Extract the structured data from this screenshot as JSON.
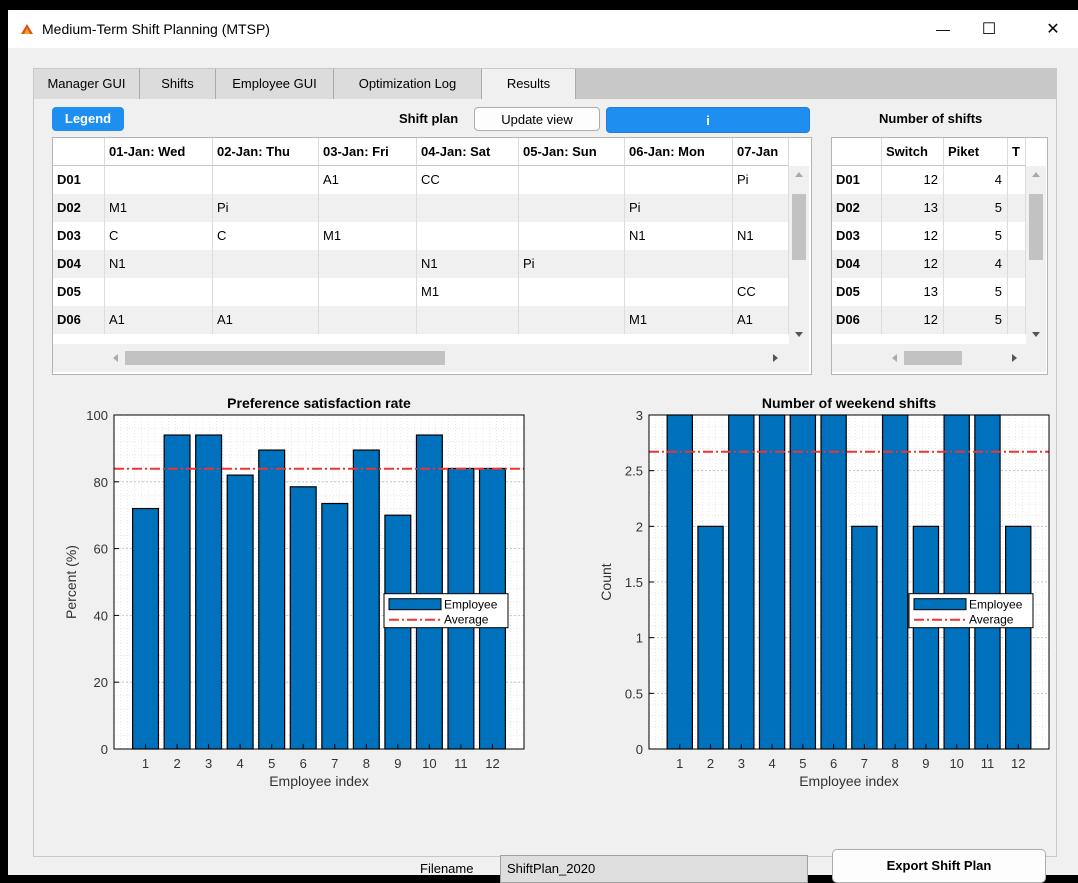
{
  "window": {
    "title": "Medium-Term Shift Planning (MTSP)",
    "minimize": "—",
    "maximize": "☐",
    "close": "✕"
  },
  "tabs": [
    {
      "label": "Manager GUI"
    },
    {
      "label": "Shifts"
    },
    {
      "label": "Employee GUI"
    },
    {
      "label": "Optimization Log"
    },
    {
      "label": "Results"
    }
  ],
  "results": {
    "legend_button": "Legend",
    "shift_plan_label": "Shift plan",
    "update_view_button": "Update view",
    "info_button": "i",
    "number_of_shifts_label": "Number of shifts"
  },
  "shift_table": {
    "columns": [
      "",
      "01-Jan: Wed",
      "02-Jan: Thu",
      "03-Jan: Fri",
      "04-Jan: Sat",
      "05-Jan: Sun",
      "06-Jan: Mon",
      "07-Jan"
    ],
    "rows": [
      [
        "D01",
        "",
        "",
        "A1",
        "CC",
        "",
        "",
        "Pi"
      ],
      [
        "D02",
        "M1",
        "Pi",
        "",
        "",
        "",
        "Pi",
        ""
      ],
      [
        "D03",
        "C",
        "C",
        "M1",
        "",
        "",
        "N1",
        "N1"
      ],
      [
        "D04",
        "N1",
        "",
        "",
        "N1",
        "Pi",
        "",
        ""
      ],
      [
        "D05",
        "",
        "",
        "",
        "M1",
        "",
        "",
        "CC"
      ],
      [
        "D06",
        "A1",
        "A1",
        "",
        "",
        "",
        "M1",
        "A1"
      ]
    ]
  },
  "count_table": {
    "columns": [
      "",
      "Switch",
      "Piket",
      "T"
    ],
    "rows": [
      [
        "D01",
        "12",
        "4"
      ],
      [
        "D02",
        "13",
        "5"
      ],
      [
        "D03",
        "12",
        "5"
      ],
      [
        "D04",
        "12",
        "4"
      ],
      [
        "D05",
        "13",
        "5"
      ],
      [
        "D06",
        "12",
        "5"
      ]
    ]
  },
  "chart_data": [
    {
      "type": "bar",
      "title": "Preference satisfaction rate",
      "xlabel": "Employee index",
      "ylabel": "Percent (%)",
      "categories": [
        "1",
        "2",
        "3",
        "4",
        "5",
        "6",
        "7",
        "8",
        "9",
        "10",
        "11",
        "12"
      ],
      "series": [
        {
          "name": "Employee",
          "values": [
            72,
            94,
            94,
            82,
            89.5,
            78.5,
            73.5,
            89.5,
            70,
            94,
            84,
            84
          ]
        },
        {
          "name": "Average",
          "values": [
            83.9
          ]
        }
      ],
      "ylim": [
        0,
        100
      ],
      "yticks": [
        "0",
        "20",
        "40",
        "60",
        "80",
        "100"
      ],
      "grid": true,
      "legend": "center-right",
      "colors": {
        "bar": "#0072bd",
        "average": "#ee3333"
      }
    },
    {
      "type": "bar",
      "title": "Number of weekend shifts",
      "xlabel": "Employee index",
      "ylabel": "Count",
      "categories": [
        "1",
        "2",
        "3",
        "4",
        "5",
        "6",
        "7",
        "8",
        "9",
        "10",
        "11",
        "12"
      ],
      "series": [
        {
          "name": "Employee",
          "values": [
            3,
            2,
            3,
            3,
            3,
            3,
            2,
            3,
            2,
            3,
            3,
            2
          ]
        },
        {
          "name": "Average",
          "values": [
            2.67
          ]
        }
      ],
      "ylim": [
        0,
        3
      ],
      "yticks": [
        "0",
        "0.5",
        "1",
        "1.5",
        "2",
        "2.5",
        "3"
      ],
      "grid": true,
      "legend": "center-right",
      "colors": {
        "bar": "#0072bd",
        "average": "#ee3333"
      }
    }
  ],
  "footer": {
    "filename_label": "Filename",
    "filename_value": "ShiftPlan_2020",
    "export_button": "Export Shift Plan"
  }
}
